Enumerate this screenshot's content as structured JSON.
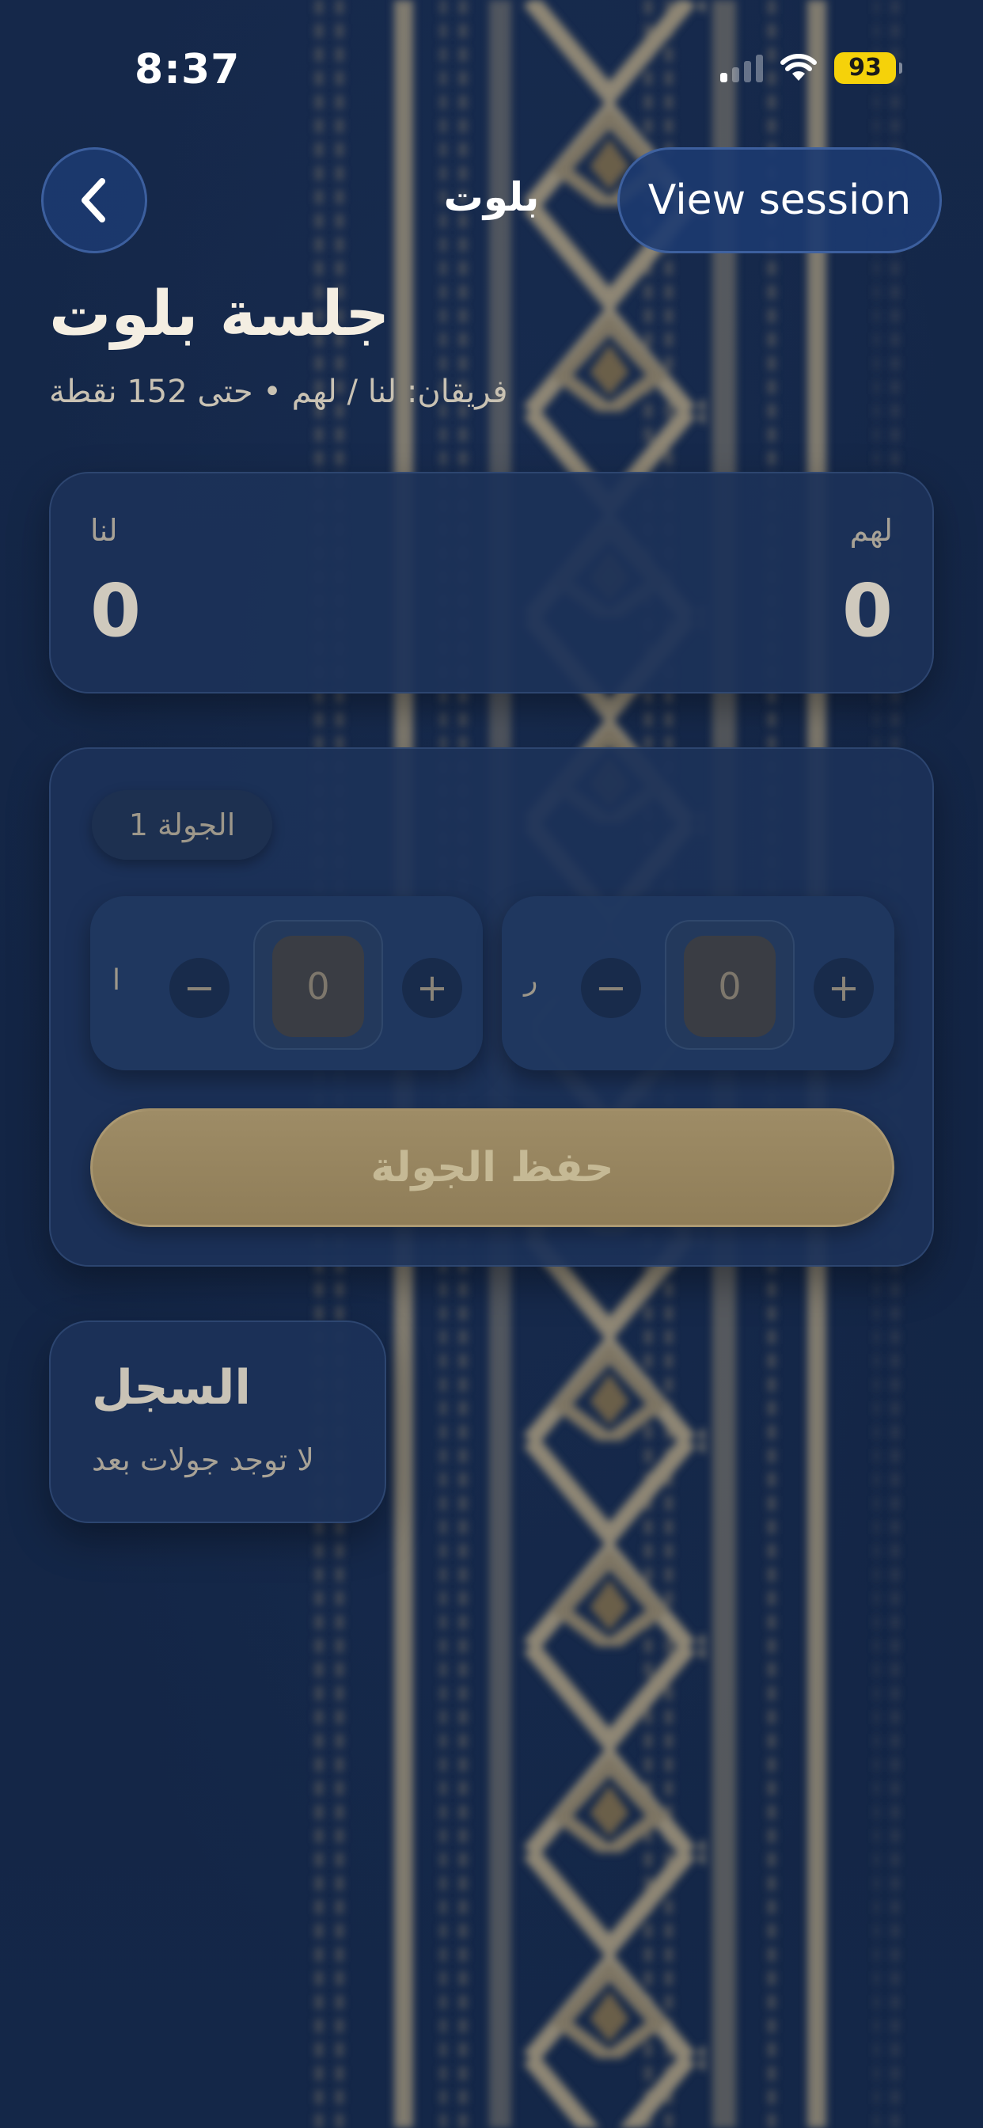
{
  "status_bar": {
    "time": "8:37",
    "battery": "93"
  },
  "nav": {
    "title": "بلوت",
    "view_session_label": "View session"
  },
  "header": {
    "title": "جلسة بلوت",
    "subtitle": "فريقان: لنا / لهم • حتى 152 نقطة"
  },
  "scoreboard": {
    "left_team_label": "لنا",
    "left_team_score": "0",
    "right_team_label": "لهم",
    "right_team_score": "0"
  },
  "round": {
    "label": "الجولة 1",
    "left_stepper": {
      "label": "ا",
      "value": "0",
      "minus": "−",
      "plus": "+"
    },
    "right_stepper": {
      "label": "ر",
      "value": "0",
      "minus": "−",
      "plus": "+"
    },
    "save_label": "حفظ الجولة"
  },
  "history": {
    "title": "السجل",
    "empty_text": "لا توجد جولات بعد"
  },
  "icons": {
    "back": "chevron-left-icon",
    "signal": "signal-icon",
    "wifi": "wifi-icon",
    "battery": "battery-icon"
  },
  "colors": {
    "background": "#142646",
    "card": "#1c3258",
    "accent_gold": "#9e8c66",
    "battery": "#f5d20a"
  }
}
